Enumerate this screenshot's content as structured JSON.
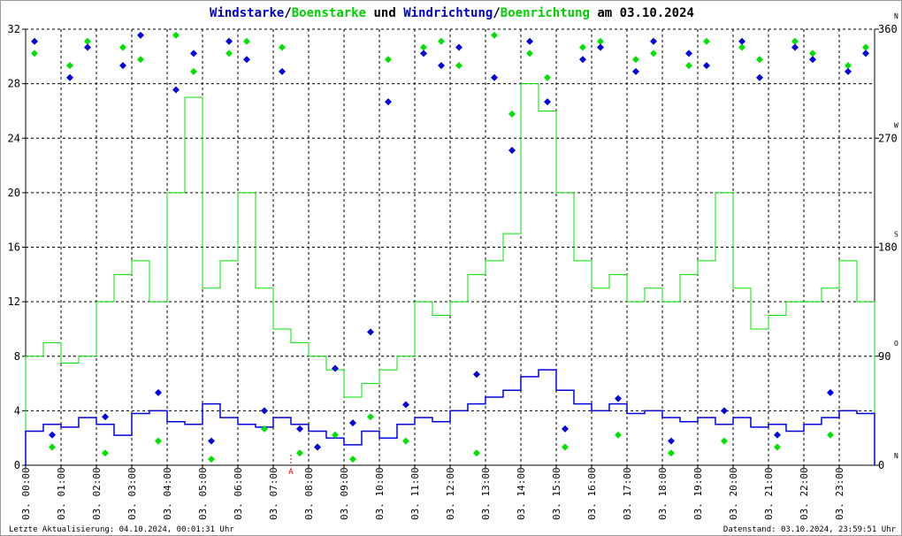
{
  "chart_data": {
    "type": "line",
    "title_parts": [
      {
        "text": "Windstarke",
        "color": "#0000c8"
      },
      {
        "text": "/",
        "color": "#000000"
      },
      {
        "text": "Boenstarke",
        "color": "#00d000"
      },
      {
        "text": " und ",
        "color": "#000000"
      },
      {
        "text": "Windrichtung",
        "color": "#0000c8"
      },
      {
        "text": "/",
        "color": "#000000"
      },
      {
        "text": "Boenrichtung",
        "color": "#00d000"
      },
      {
        "text": " am 03.10.2024",
        "color": "#000000"
      }
    ],
    "ylim": [
      0,
      32
    ],
    "yticks": [
      0,
      4,
      8,
      12,
      16,
      20,
      24,
      28,
      32
    ],
    "y2lim": [
      0,
      360
    ],
    "y2ticks": [
      {
        "v": 0,
        "dir": "N"
      },
      {
        "v": 90,
        "dir": "O"
      },
      {
        "v": 180,
        "dir": "S"
      },
      {
        "v": 270,
        "dir": "W"
      },
      {
        "v": 360,
        "dir": "N"
      }
    ],
    "xticks": [
      "03. 00:00",
      "03. 01:00",
      "03. 02:00",
      "03. 03:00",
      "03. 04:00",
      "03. 05:00",
      "03. 06:00",
      "03. 07:00",
      "03. 08:00",
      "03. 09:00",
      "03. 10:00",
      "03. 11:00",
      "03. 12:00",
      "03. 13:00",
      "03. 14:00",
      "03. 15:00",
      "03. 16:00",
      "03. 17:00",
      "03. 18:00",
      "03. 19:00",
      "03. 20:00",
      "03. 21:00",
      "03. 22:00",
      "03. 23:00"
    ],
    "x_hours_range": [
      0,
      24
    ],
    "marker": {
      "label": "A",
      "hour": 7.5,
      "color": "#e00000"
    },
    "grid": true,
    "series": [
      {
        "name": "Boenstarke",
        "color": "#00e000",
        "interval_min": 30,
        "values": [
          8,
          9,
          7.5,
          8,
          12,
          14,
          15,
          12,
          20,
          27,
          13,
          15,
          20,
          13,
          10,
          9,
          8,
          7,
          5,
          6,
          7,
          8,
          12,
          11,
          12,
          14,
          15,
          17,
          28,
          26,
          20,
          15,
          13,
          14,
          12,
          13,
          12,
          14,
          15,
          20,
          13,
          10,
          11,
          12,
          12,
          13,
          15,
          12
        ]
      },
      {
        "name": "Windstarke",
        "color": "#0000e0",
        "interval_min": 30,
        "values": [
          2.5,
          3,
          2.8,
          3.5,
          3,
          2.2,
          3.8,
          4,
          3.2,
          3,
          4.5,
          3.5,
          3,
          2.8,
          3.5,
          3,
          2.5,
          2,
          1.5,
          2.5,
          2,
          3,
          3.5,
          3.2,
          4,
          4.5,
          5,
          5.5,
          6.5,
          7,
          5.5,
          4.5,
          4,
          4.5,
          3.8,
          4,
          3.5,
          3.2,
          3.5,
          3,
          3.5,
          2.8,
          3,
          2.5,
          3,
          3.5,
          4,
          3.8
        ]
      },
      {
        "name": "Boenrichtung",
        "color": "#00e000",
        "interval_min": 30,
        "axis": "right",
        "values": [
          340,
          15,
          330,
          350,
          10,
          345,
          335,
          20,
          355,
          325,
          5,
          340,
          350,
          30,
          345,
          10,
          15,
          25,
          5,
          40,
          335,
          20,
          345,
          350,
          330,
          10,
          355,
          290,
          340,
          320,
          15,
          345,
          350,
          25,
          335,
          340,
          10,
          330,
          350,
          20,
          345,
          335,
          15,
          350,
          340,
          25,
          330,
          345
        ]
      },
      {
        "name": "Windrichtung",
        "color": "#0000e0",
        "interval_min": 30,
        "axis": "right",
        "values": [
          350,
          25,
          320,
          345,
          40,
          330,
          355,
          60,
          310,
          340,
          20,
          350,
          335,
          45,
          325,
          30,
          15,
          80,
          35,
          110,
          300,
          50,
          340,
          330,
          345,
          75,
          320,
          260,
          350,
          300,
          30,
          335,
          345,
          55,
          325,
          350,
          20,
          340,
          330,
          45,
          350,
          320,
          25,
          345,
          335,
          60,
          325,
          340
        ]
      }
    ]
  },
  "footer": {
    "last_update": "Letzte Aktualisierung: 04.10.2024, 00:01:31 Uhr",
    "data_state": "Datenstand: 03.10.2024, 23:59:51 Uhr"
  }
}
